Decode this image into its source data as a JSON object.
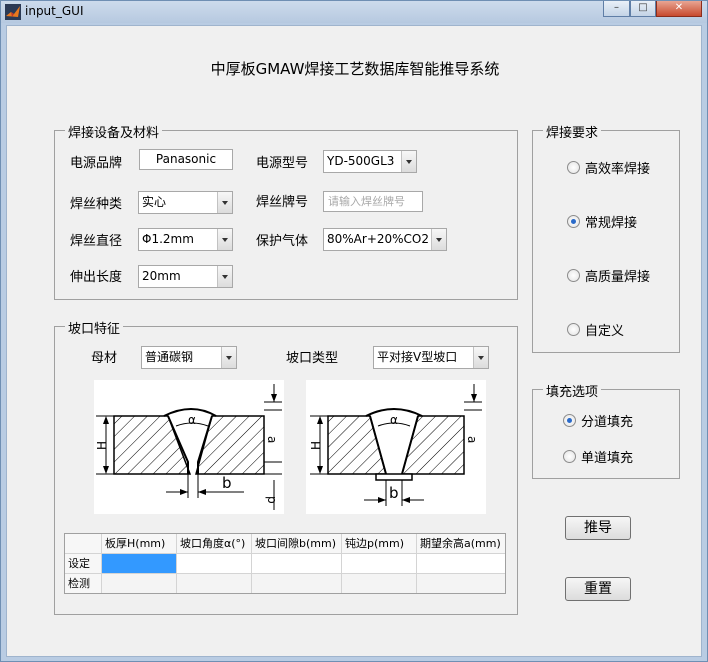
{
  "window": {
    "title": "input_GUI",
    "controls": [
      "–",
      "□",
      "✕"
    ]
  },
  "heading": "中厚板GMAW焊接工艺数据库智能推导系统",
  "equipment": {
    "title": "焊接设备及材料",
    "power_brand_label": "电源品牌",
    "power_brand_value": "Panasonic",
    "power_model_label": "电源型号",
    "power_model_value": "YD-500GL3",
    "wire_type_label": "焊丝种类",
    "wire_type_value": "实心",
    "wire_brand_label": "焊丝牌号",
    "wire_brand_placeholder": "请输入焊丝牌号",
    "wire_dia_label": "焊丝直径",
    "wire_dia_value": "Φ1.2mm",
    "gas_label": "保护气体",
    "gas_value": "80%Ar+20%CO2",
    "stickout_label": "伸出长度",
    "stickout_value": "20mm"
  },
  "groove": {
    "title": "坡口特征",
    "base_label": "母材",
    "base_value": "普通碳钢",
    "type_label": "坡口类型",
    "type_value": "平对接V型坡口",
    "fig1": {
      "H": "H",
      "alpha": "α",
      "a": "a",
      "b": "b",
      "p": "p"
    },
    "fig2": {
      "H": "H",
      "alpha": "α",
      "a": "a",
      "b": "b"
    }
  },
  "table": {
    "columns": [
      "板厚H(mm)",
      "坡口角度α(°)",
      "坡口间隙b(mm)",
      "钝边p(mm)",
      "期望余高a(mm)"
    ],
    "rows": [
      {
        "label": "设定",
        "cells": [
          "",
          "",
          "",
          "",
          ""
        ]
      },
      {
        "label": "检测",
        "cells": [
          "",
          "",
          "",
          "",
          ""
        ]
      }
    ]
  },
  "requirement": {
    "title": "焊接要求",
    "options": [
      "高效率焊接",
      "常规焊接",
      "高质量焊接",
      "自定义"
    ],
    "selected": 1
  },
  "fill": {
    "title": "填充选项",
    "options": [
      "分道填充",
      "单道填充"
    ],
    "selected": 0
  },
  "buttons": {
    "derive": "推导",
    "reset": "重置"
  },
  "colors": {
    "selected_cell": "#3399ff",
    "radio_dot": "#2a6ac9"
  }
}
